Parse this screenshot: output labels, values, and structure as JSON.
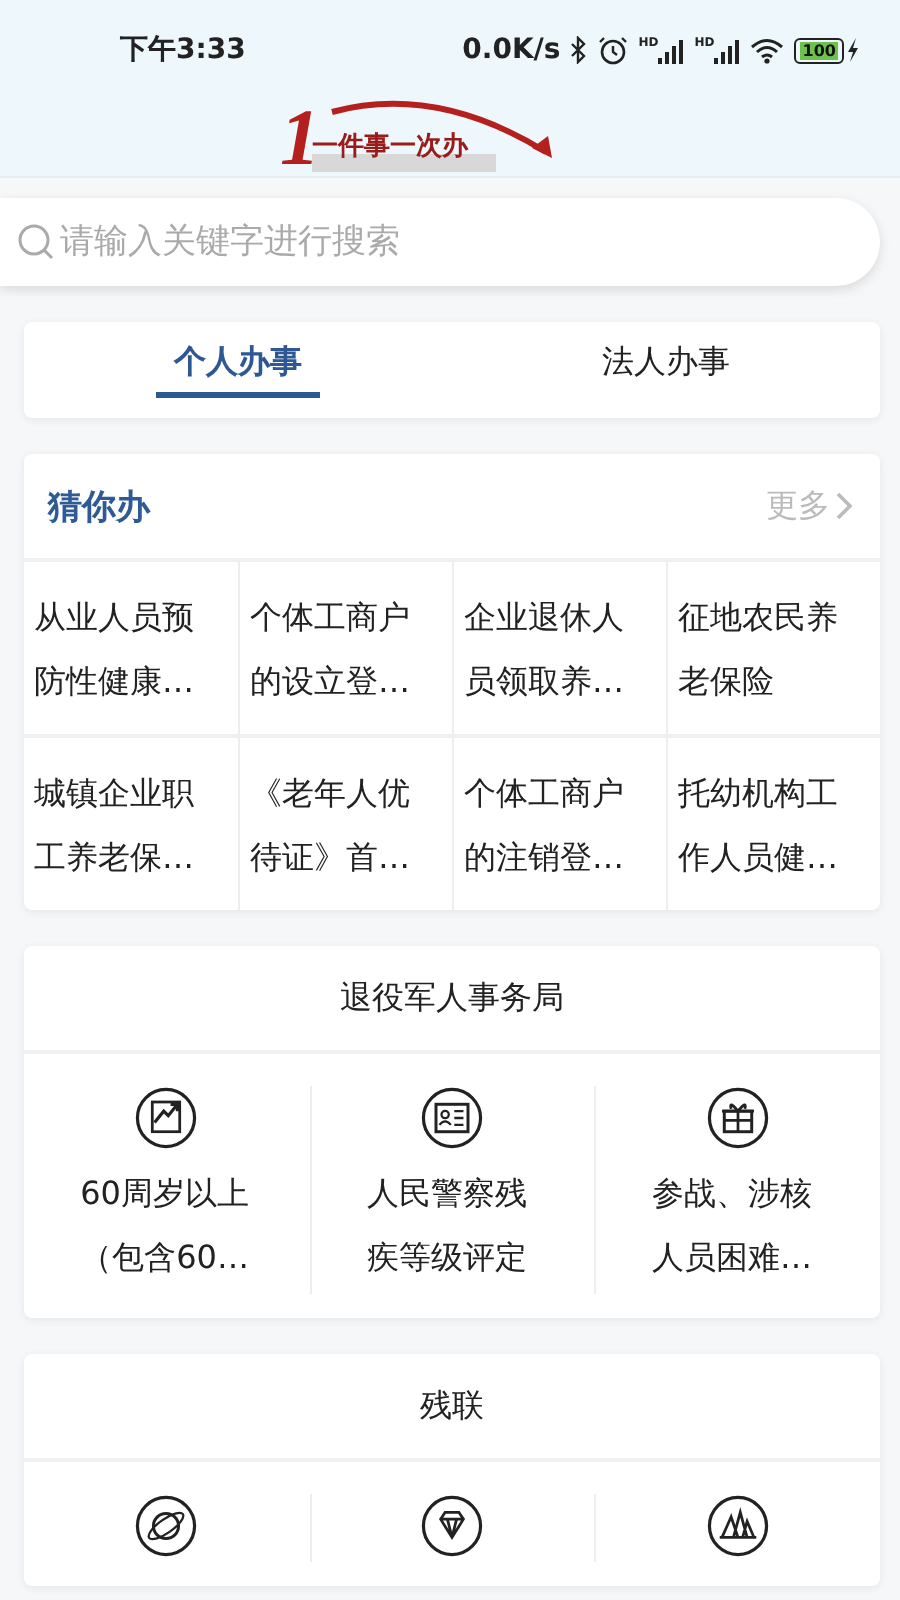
{
  "status_bar": {
    "time": "下午3:33",
    "net_speed": "0.0K/s",
    "signal_labels": [
      "HD",
      "HD"
    ],
    "battery": "100",
    "charging": true
  },
  "header": {
    "logo_numeral": "1",
    "logo_text": "一件事一次办"
  },
  "search": {
    "placeholder": "请输入关键字进行搜索"
  },
  "tabs": [
    {
      "label": "个人办事",
      "selected": true
    },
    {
      "label": "法人办事",
      "selected": false
    }
  ],
  "guess": {
    "title": "猜你办",
    "more": "更多",
    "items": [
      {
        "text": "从业人员预防性健康…"
      },
      {
        "text": "个体工商户的设立登…"
      },
      {
        "text": "企业退休人员领取养…"
      },
      {
        "text": "征地农民养老保险"
      },
      {
        "text": "城镇企业职工养老保…"
      },
      {
        "text": "《老年人优待证》首…"
      },
      {
        "text": "个体工商户的注销登…"
      },
      {
        "text": "托幼机构工作人员健…"
      }
    ]
  },
  "departments": [
    {
      "title": "退役军人事务局",
      "items": [
        {
          "text": "60周岁以上（包含60…"
        },
        {
          "text": "人民警察残疾等级评定"
        },
        {
          "text": "参战、涉核人员困难…"
        }
      ]
    },
    {
      "title": "残联"
    }
  ]
}
